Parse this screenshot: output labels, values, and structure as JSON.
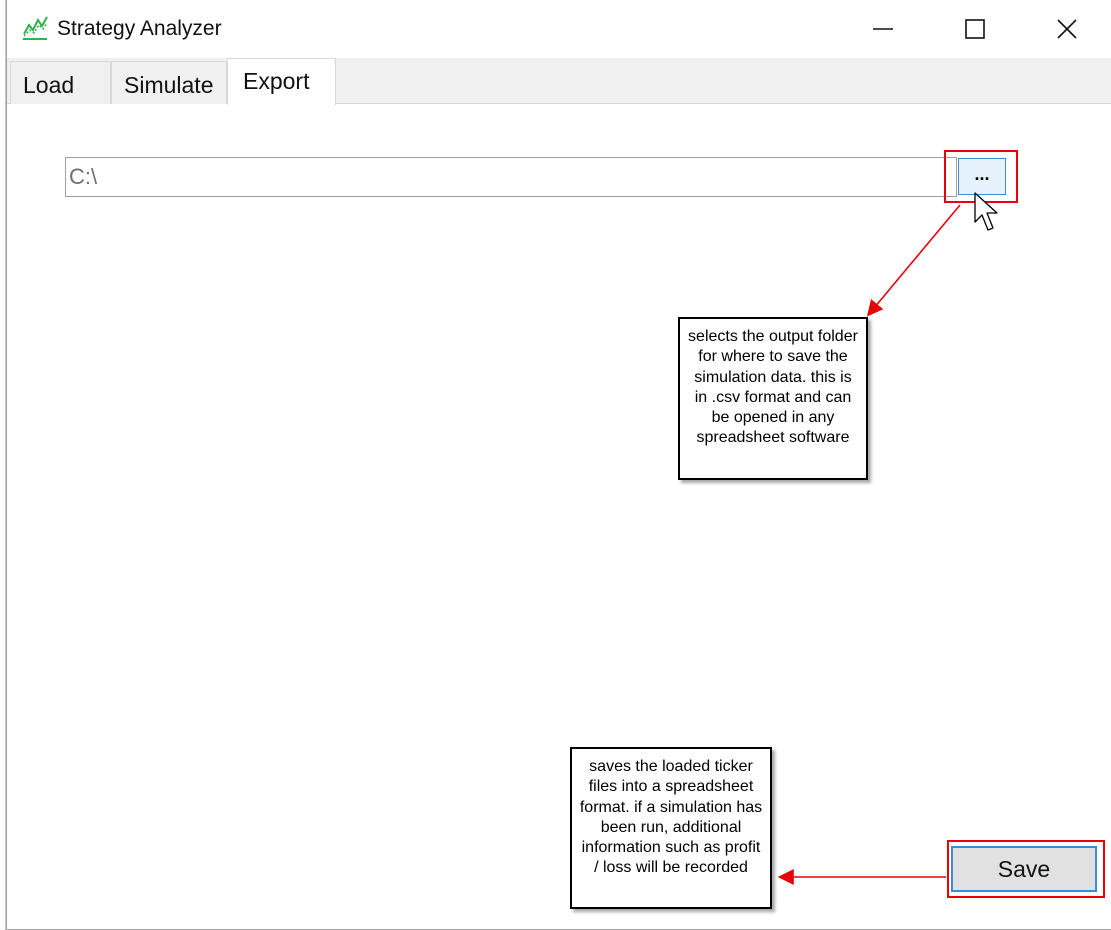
{
  "window": {
    "title": "Strategy Analyzer",
    "app_icon": "chart-line-icon",
    "controls": {
      "minimize": "minimize-icon",
      "maximize": "maximize-icon",
      "close": "close-icon"
    }
  },
  "tabs": [
    {
      "label": "Load",
      "active": false
    },
    {
      "label": "Simulate",
      "active": false
    },
    {
      "label": "Export",
      "active": true
    }
  ],
  "export": {
    "path_value": "C:\\",
    "browse_label": "...",
    "save_label": "Save"
  },
  "annotations": {
    "browse_callout": "selects the output folder for where to save the simulation data. this is in .csv format and can be opened in any spreadsheet software",
    "save_callout": "saves the loaded ticker files into a spreadsheet format. if a simulation has been run, additional information such as profit / loss will be recorded"
  },
  "colors": {
    "highlight_red": "#e8000b",
    "accent_blue": "#3c8bd9",
    "icon_green": "#2db34a"
  }
}
